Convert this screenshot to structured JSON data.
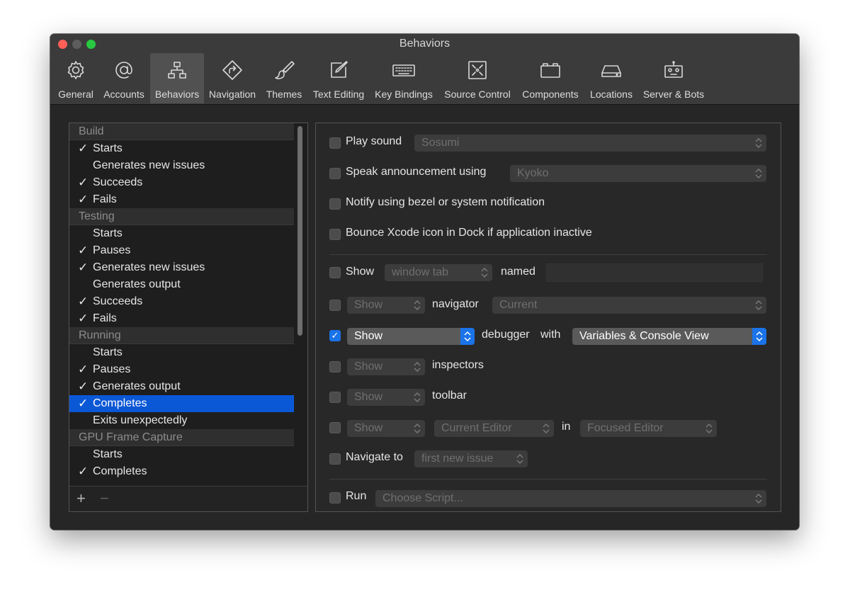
{
  "window": {
    "title": "Behaviors"
  },
  "toolbar": {
    "tabs": [
      {
        "label": "General",
        "icon": "gear-icon"
      },
      {
        "label": "Accounts",
        "icon": "at-sign-icon"
      },
      {
        "label": "Behaviors",
        "icon": "hierarchy-icon",
        "active": true
      },
      {
        "label": "Navigation",
        "icon": "navigation-arrow-icon"
      },
      {
        "label": "Themes",
        "icon": "paintbrush-icon"
      },
      {
        "label": "Text Editing",
        "icon": "pencil-square-icon"
      },
      {
        "label": "Key Bindings",
        "icon": "keyboard-icon"
      },
      {
        "label": "Source Control",
        "icon": "source-control-icon"
      },
      {
        "label": "Components",
        "icon": "components-box-icon"
      },
      {
        "label": "Locations",
        "icon": "drive-icon"
      },
      {
        "label": "Server & Bots",
        "icon": "robot-icon"
      }
    ]
  },
  "behaviors": {
    "groups": [
      {
        "name": "Build",
        "items": [
          {
            "label": "Starts",
            "checked": true
          },
          {
            "label": "Generates new issues",
            "checked": false
          },
          {
            "label": "Succeeds",
            "checked": true
          },
          {
            "label": "Fails",
            "checked": true
          }
        ]
      },
      {
        "name": "Testing",
        "items": [
          {
            "label": "Starts",
            "checked": false
          },
          {
            "label": "Pauses",
            "checked": true
          },
          {
            "label": "Generates new issues",
            "checked": true
          },
          {
            "label": "Generates output",
            "checked": false
          },
          {
            "label": "Succeeds",
            "checked": true
          },
          {
            "label": "Fails",
            "checked": true
          }
        ]
      },
      {
        "name": "Running",
        "items": [
          {
            "label": "Starts",
            "checked": false
          },
          {
            "label": "Pauses",
            "checked": true
          },
          {
            "label": "Generates output",
            "checked": true
          },
          {
            "label": "Completes",
            "checked": true,
            "selected": true
          },
          {
            "label": "Exits unexpectedly",
            "checked": false
          }
        ]
      },
      {
        "name": "GPU Frame Capture",
        "items": [
          {
            "label": "Starts",
            "checked": false
          },
          {
            "label": "Completes",
            "checked": true
          }
        ]
      }
    ],
    "add_label": "+",
    "remove_label": "−",
    "check_glyph": "✓"
  },
  "settings": {
    "play_sound": {
      "label": "Play sound",
      "value": "Sosumi",
      "checked": false
    },
    "speak": {
      "label": "Speak announcement using",
      "value": "Kyoko",
      "checked": false
    },
    "notify": {
      "label": "Notify using bezel or system notification",
      "checked": false
    },
    "bounce": {
      "label": "Bounce Xcode icon in Dock if application inactive",
      "checked": false
    },
    "show_tab": {
      "label": "Show",
      "value": "window tab",
      "named_label": "named",
      "named_value": "",
      "checked": false
    },
    "navigator": {
      "value": "Show",
      "label": "navigator",
      "target": "Current",
      "checked": false
    },
    "debugger": {
      "value": "Show",
      "label": "debugger",
      "with_label": "with",
      "target": "Variables & Console View",
      "checked": true
    },
    "inspectors": {
      "value": "Show",
      "label": "inspectors",
      "checked": false
    },
    "toolbar_row": {
      "value": "Show",
      "label": "toolbar",
      "checked": false
    },
    "editor": {
      "value": "Show",
      "editor": "Current Editor",
      "in_label": "in",
      "target": "Focused Editor",
      "checked": false
    },
    "navigate": {
      "label": "Navigate to",
      "value": "first new issue",
      "checked": false
    },
    "run": {
      "label": "Run",
      "value": "Choose Script...",
      "checked": false
    }
  },
  "colors": {
    "accent": "#1a73e8",
    "selection": "#0b58d6",
    "background": "#262626"
  }
}
